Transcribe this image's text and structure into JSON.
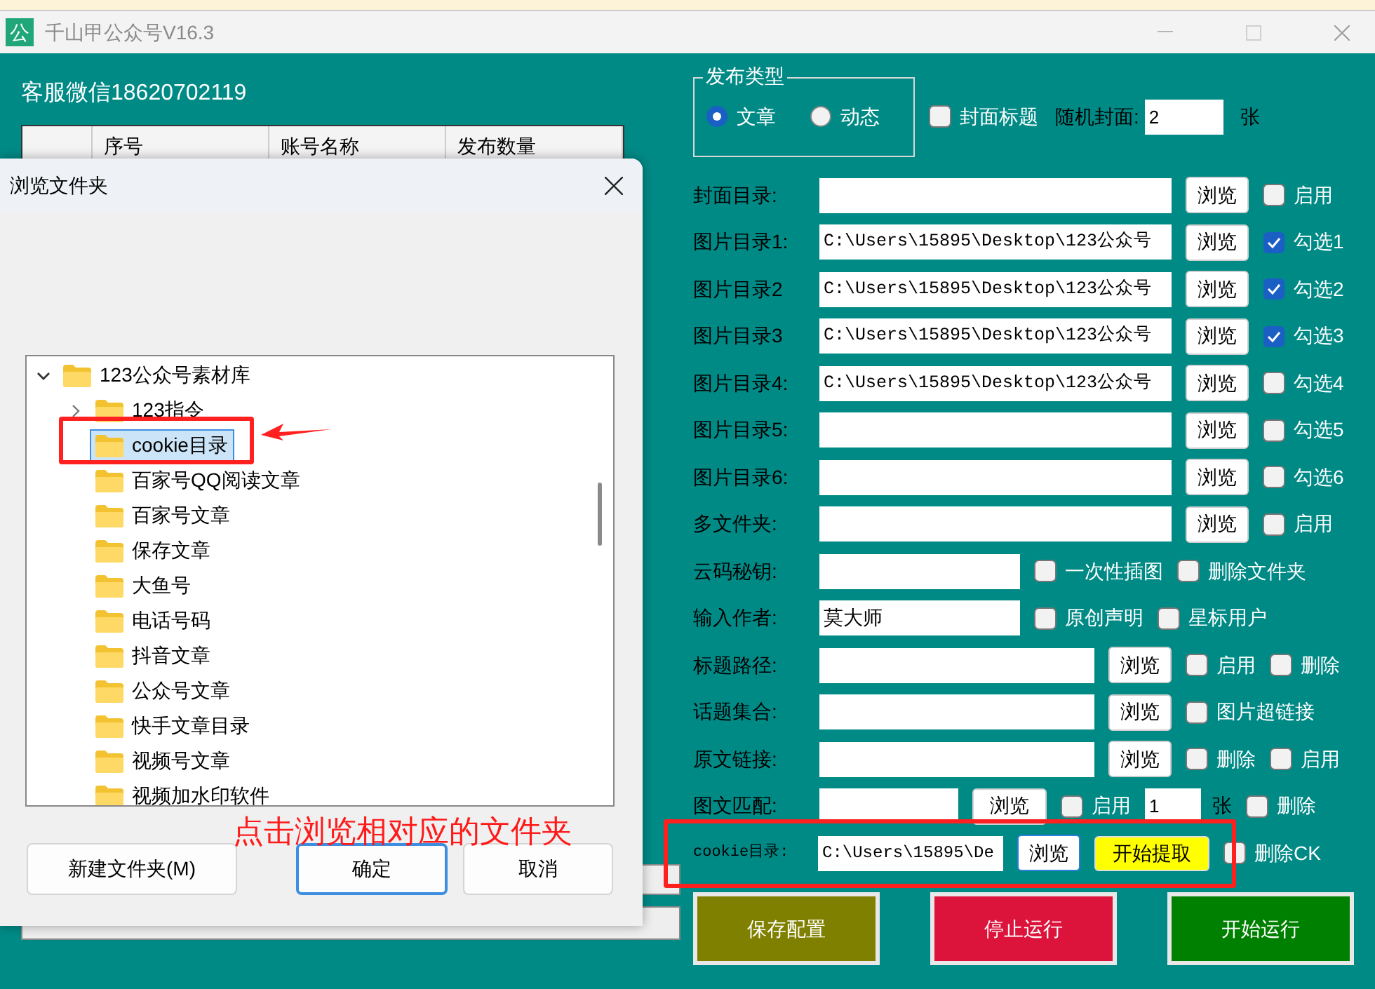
{
  "window": {
    "app_icon": "公",
    "title": "千山甲公众号V16.3"
  },
  "contact": "客服微信18620702119",
  "accounts_table": {
    "columns": [
      "序号",
      "账号名称",
      "发布数量"
    ]
  },
  "publish_type": {
    "legend": "发布类型",
    "options": [
      {
        "label": "文章",
        "selected": true
      },
      {
        "label": "动态",
        "selected": false
      }
    ]
  },
  "cover_title": {
    "label": "封面标题",
    "checked": false
  },
  "random_cover": {
    "label": "随机封面:",
    "value": "2",
    "unit": "张"
  },
  "rows": [
    {
      "label": "封面目录:",
      "items": [
        {
          "kind": "field"
        },
        {
          "kind": "browse",
          "label": "浏览",
          "focused": false
        },
        {
          "kind": "check",
          "label": "启用",
          "checked": false
        }
      ]
    },
    {
      "label": "图片目录1:",
      "items": [
        {
          "kind": "field",
          "value": "C:\\Users\\15895\\Desktop\\123公众号"
        },
        {
          "kind": "browse",
          "label": "浏览",
          "focused": false
        },
        {
          "kind": "check",
          "label": "勾选1",
          "checked": true
        }
      ]
    },
    {
      "label": "图片目录2",
      "items": [
        {
          "kind": "field",
          "value": "C:\\Users\\15895\\Desktop\\123公众号"
        },
        {
          "kind": "browse",
          "label": "浏览",
          "focused": false
        },
        {
          "kind": "check",
          "label": "勾选2",
          "checked": true
        }
      ]
    },
    {
      "label": "图片目录3",
      "items": [
        {
          "kind": "field",
          "value": "C:\\Users\\15895\\Desktop\\123公众号"
        },
        {
          "kind": "browse",
          "label": "浏览",
          "focused": false
        },
        {
          "kind": "check",
          "label": "勾选3",
          "checked": true
        }
      ]
    },
    {
      "label": "图片目录4:",
      "items": [
        {
          "kind": "field",
          "value": "C:\\Users\\15895\\Desktop\\123公众号"
        },
        {
          "kind": "browse",
          "label": "浏览",
          "focused": false
        },
        {
          "kind": "check",
          "label": "勾选4",
          "checked": false
        }
      ]
    },
    {
      "label": "图片目录5:",
      "items": [
        {
          "kind": "field"
        },
        {
          "kind": "browse",
          "label": "浏览",
          "focused": false
        },
        {
          "kind": "check",
          "label": "勾选5",
          "checked": false
        }
      ]
    },
    {
      "label": "图片目录6:",
      "items": [
        {
          "kind": "field"
        },
        {
          "kind": "browse",
          "label": "浏览",
          "focused": false
        },
        {
          "kind": "check",
          "label": "勾选6",
          "checked": false
        }
      ]
    },
    {
      "label": "多文件夹:",
      "items": [
        {
          "kind": "field"
        },
        {
          "kind": "browse",
          "label": "浏览",
          "focused": false
        },
        {
          "kind": "check",
          "label": "启用",
          "checked": false
        }
      ]
    },
    {
      "label": "云码秘钥:",
      "items": [
        {
          "kind": "field"
        },
        {
          "kind": "check",
          "label": "一次性插图",
          "checked": false
        },
        {
          "kind": "check",
          "label": "删除文件夹",
          "checked": false
        }
      ]
    },
    {
      "label": "输入作者:",
      "items": [
        {
          "kind": "field",
          "value": "莫大师"
        },
        {
          "kind": "check",
          "label": "原创声明",
          "checked": false
        },
        {
          "kind": "check",
          "label": "星标用户",
          "checked": false
        }
      ]
    },
    {
      "label": "标题路径:",
      "items": [
        {
          "kind": "field"
        },
        {
          "kind": "browse",
          "label": "浏览",
          "focused": false
        },
        {
          "kind": "check",
          "label": "启用",
          "checked": false
        },
        {
          "kind": "check",
          "label": "删除",
          "checked": false
        }
      ]
    },
    {
      "label": "话题集合:",
      "items": [
        {
          "kind": "field"
        },
        {
          "kind": "browse",
          "label": "浏览",
          "focused": false
        },
        {
          "kind": "check",
          "label": "图片超链接",
          "checked": false
        }
      ]
    },
    {
      "label": "原文链接:",
      "items": [
        {
          "kind": "field"
        },
        {
          "kind": "browse",
          "label": "浏览",
          "focused": false
        },
        {
          "kind": "check",
          "label": "删除",
          "checked": false
        },
        {
          "kind": "check",
          "label": "启用",
          "checked": false
        }
      ]
    },
    {
      "label": "图文匹配:",
      "items": [
        {
          "kind": "field"
        },
        {
          "kind": "browse",
          "label": "浏览",
          "focused": false
        },
        {
          "kind": "check",
          "label": "启用",
          "checked": false
        },
        {
          "kind": "number",
          "value": "1"
        },
        {
          "kind": "unit",
          "label": "张"
        },
        {
          "kind": "check",
          "label": "删除",
          "checked": false
        }
      ]
    },
    {
      "label": "cookie目录:",
      "items": [
        {
          "kind": "field",
          "value": "C:\\Users\\15895\\De"
        },
        {
          "kind": "browse",
          "label": "浏览",
          "focused": true
        },
        {
          "kind": "action",
          "label": "开始提取"
        },
        {
          "kind": "check",
          "label": "删除CK",
          "checked": false
        }
      ]
    }
  ],
  "buttons": [
    {
      "label": "保存配置",
      "kind": "save"
    },
    {
      "label": "停止运行",
      "kind": "stop"
    },
    {
      "label": "开始运行",
      "kind": "start"
    }
  ],
  "dialog": {
    "title": "浏览文件夹",
    "tree": [
      {
        "label": "123公众号素材库",
        "expanded": true,
        "selected": false,
        "children": [
          {
            "label": "123指令",
            "expanded": false,
            "selected": false
          },
          {
            "label": "cookie目录",
            "selected": true
          },
          {
            "label": "百家号QQ阅读文章",
            "selected": false
          },
          {
            "label": "百家号文章",
            "selected": false
          },
          {
            "label": "保存文章",
            "selected": false
          },
          {
            "label": "大鱼号",
            "selected": false
          },
          {
            "label": "电话号码",
            "selected": false
          },
          {
            "label": "抖音文章",
            "selected": false
          },
          {
            "label": "公众号文章",
            "selected": false
          },
          {
            "label": "快手文章目录",
            "selected": false
          },
          {
            "label": "视频号文章",
            "selected": false
          },
          {
            "label": "视频加水印软件",
            "selected": false
          }
        ]
      }
    ],
    "buttons": [
      {
        "label": "新建文件夹(M)",
        "default": false
      },
      {
        "label": "确定",
        "default": true
      },
      {
        "label": "取消",
        "default": false
      }
    ]
  },
  "annotation": {
    "text": "点击浏览相对应的文件夹"
  }
}
